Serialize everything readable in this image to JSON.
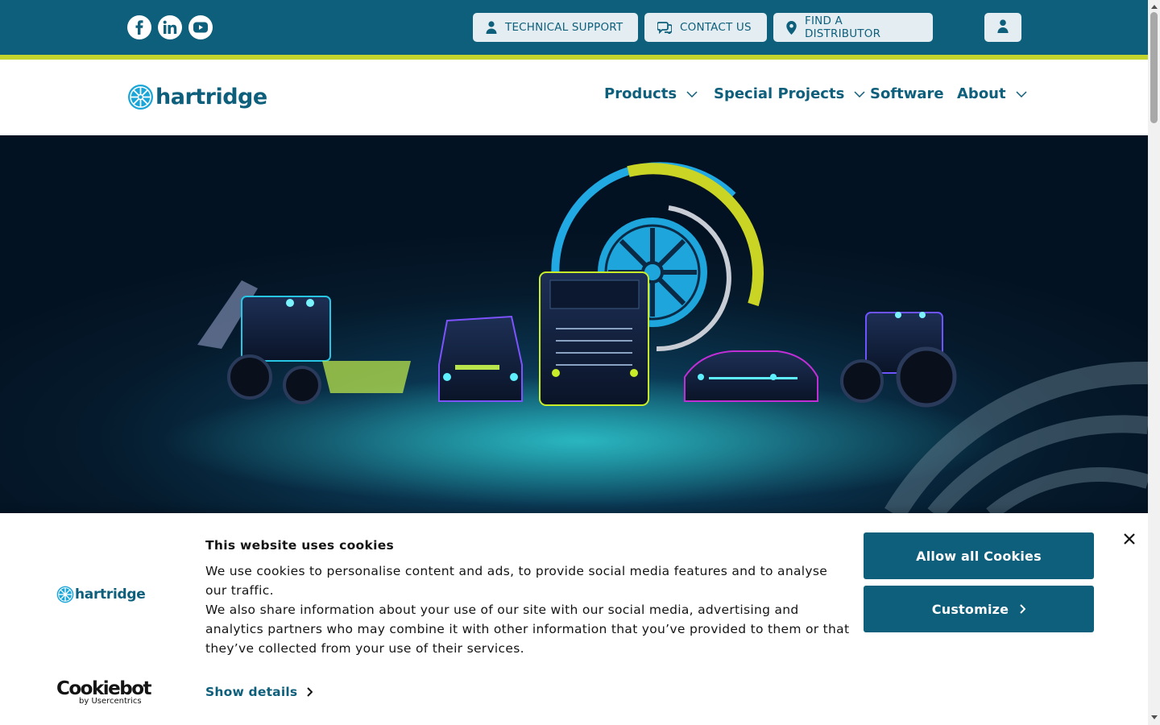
{
  "colors": {
    "brand_teal": "#0e5f7b",
    "accent_lime": "#c3d52d",
    "button_bg": "#e4eef2",
    "logo_cyan": "#1aa6d8"
  },
  "topbar": {
    "social": [
      {
        "name": "facebook-icon"
      },
      {
        "name": "linkedin-icon"
      },
      {
        "name": "youtube-icon"
      }
    ],
    "buttons": [
      {
        "label": "TECHNICAL SUPPORT",
        "icon": "person-icon"
      },
      {
        "label": "CONTACT US",
        "icon": "chat-icon"
      },
      {
        "label": "FIND A DISTRIBUTOR",
        "icon": "location-pin-icon"
      }
    ],
    "account_icon": "user-icon"
  },
  "header": {
    "logo_text": "hartridge",
    "nav": [
      {
        "label": "Products",
        "dropdown": true
      },
      {
        "label": "Special Projects",
        "dropdown": true
      },
      {
        "label": "Software",
        "dropdown": false
      },
      {
        "label": "About",
        "dropdown": true
      }
    ]
  },
  "cookie_banner": {
    "logo_text": "hartridge",
    "title": "This website uses cookies",
    "paragraph_1": "We use cookies to personalise content and ads, to provide social media features and to analyse our traffic.",
    "paragraph_2": "We also share information about your use of our site with our social media, advertising and analytics partners who may combine it with other information that you’ve provided to them or that they’ve collected from your use of their services.",
    "show_details": "Show details",
    "allow_all": "Allow all Cookies",
    "customize": "Customize",
    "cookiebot_brand": "Cookiebot",
    "cookiebot_sub": "by Usercentrics"
  }
}
